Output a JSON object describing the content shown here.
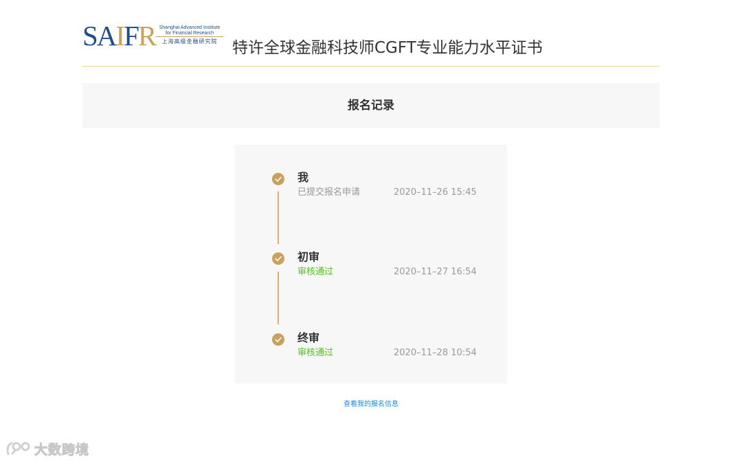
{
  "header": {
    "logo": {
      "mark": "SAIFR",
      "en_line1": "Shanghai Advanced Institute",
      "en_line2": "for Financial Research",
      "cn": "上海高级金融研究院"
    },
    "title": "特许全球金融科技师CGFT专业能力水平证书"
  },
  "section": {
    "title": "报名记录"
  },
  "timeline": {
    "steps": [
      {
        "title": "我",
        "status": "已提交报名申请",
        "status_color": "#999999",
        "time": "2020–11–26 15:45"
      },
      {
        "title": "初审",
        "status": "审核通过",
        "status_color": "#52c41a",
        "time": "2020–11–27 16:54"
      },
      {
        "title": "终审",
        "status": "审核通过",
        "status_color": "#52c41a",
        "time": "2020–11–28 10:54"
      }
    ]
  },
  "link": {
    "label": "查看我的报名信息"
  },
  "watermark": {
    "text": "大数跨境"
  },
  "colors": {
    "accent_gold": "#c9a15b",
    "brand_blue": "#1c4f8c",
    "success_green": "#52c41a",
    "link_blue": "#1e88e5"
  },
  "icons": [
    "saifr-logo",
    "check-circle-icon",
    "watermark-logo-icon"
  ]
}
